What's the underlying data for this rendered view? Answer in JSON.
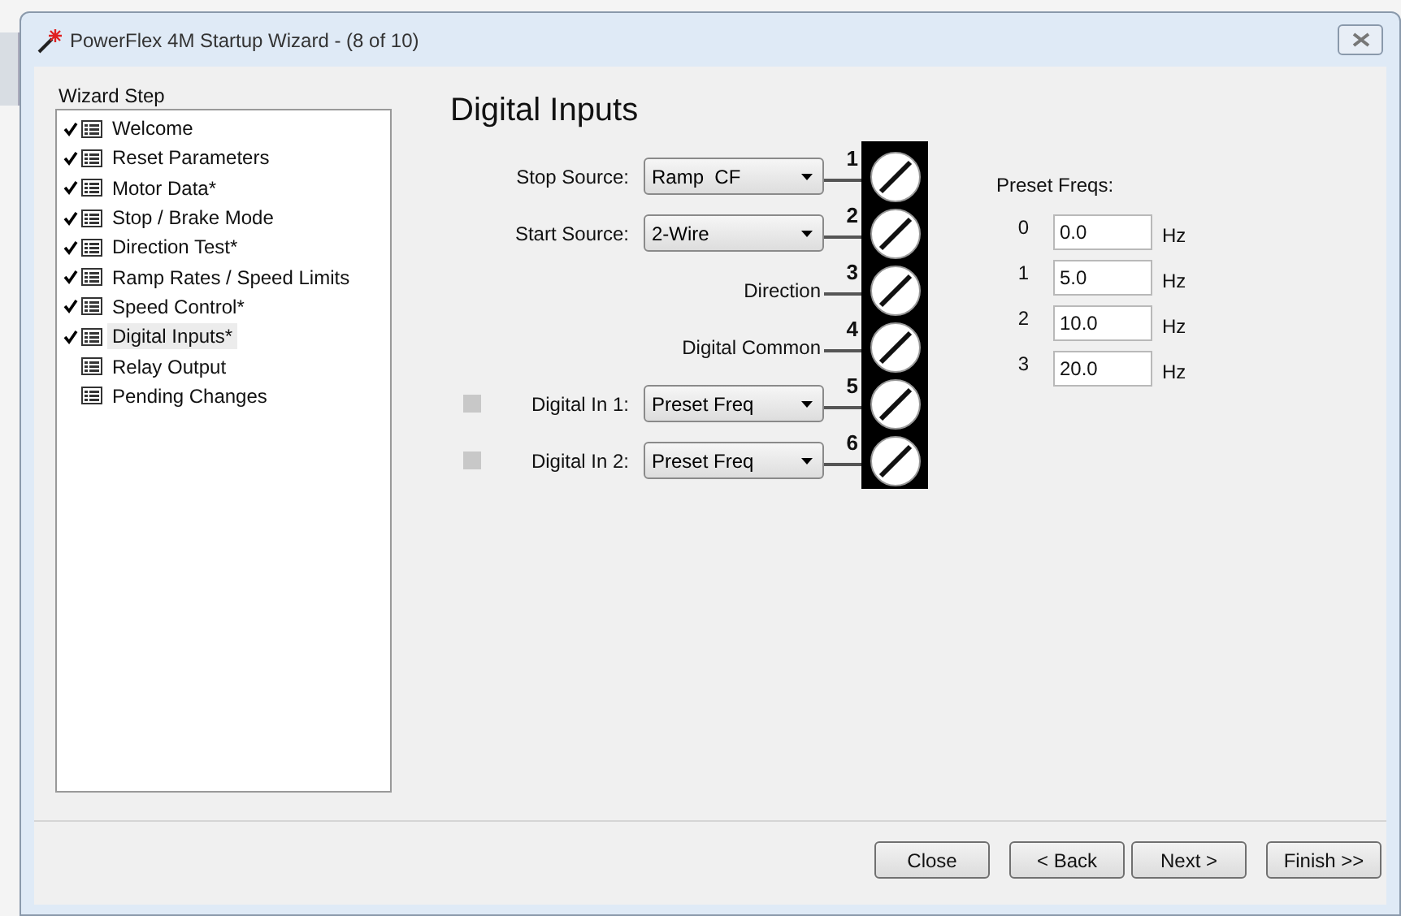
{
  "window": {
    "title": "PowerFlex 4M Startup Wizard - (8 of 10)"
  },
  "sidebar": {
    "title": "Wizard Step",
    "items": [
      {
        "label": "Welcome",
        "checked": true,
        "selected": false
      },
      {
        "label": "Reset Parameters",
        "checked": true,
        "selected": false
      },
      {
        "label": "Motor Data*",
        "checked": true,
        "selected": false
      },
      {
        "label": "Stop / Brake Mode",
        "checked": true,
        "selected": false
      },
      {
        "label": "Direction Test*",
        "checked": true,
        "selected": false
      },
      {
        "label": "Ramp Rates / Speed Limits",
        "checked": true,
        "selected": false
      },
      {
        "label": "Speed Control*",
        "checked": true,
        "selected": false
      },
      {
        "label": "Digital Inputs*",
        "checked": true,
        "selected": true
      },
      {
        "label": "Relay Output",
        "checked": false,
        "selected": false
      },
      {
        "label": "Pending Changes",
        "checked": false,
        "selected": false
      }
    ]
  },
  "page": {
    "title": "Digital Inputs",
    "terminals": [
      {
        "kind": "select",
        "number": "1",
        "label": "Stop Source:",
        "value": "Ramp  CF"
      },
      {
        "kind": "select",
        "number": "2",
        "label": "Start Source:",
        "value": "2-Wire"
      },
      {
        "kind": "text",
        "number": "3",
        "label": "Direction"
      },
      {
        "kind": "text",
        "number": "4",
        "label": "Digital Common"
      },
      {
        "kind": "input",
        "number": "5",
        "label": "Digital In 1:",
        "value": "Preset Freq",
        "on": false
      },
      {
        "kind": "input",
        "number": "6",
        "label": "Digital In 2:",
        "value": "Preset Freq",
        "on": false
      }
    ],
    "preset_freqs": {
      "title": "Preset Freqs:",
      "rows": [
        {
          "index": "0",
          "value": "0.0",
          "unit": "Hz"
        },
        {
          "index": "1",
          "value": "5.0",
          "unit": "Hz"
        },
        {
          "index": "2",
          "value": "10.0",
          "unit": "Hz"
        },
        {
          "index": "3",
          "value": "20.0",
          "unit": "Hz"
        }
      ]
    }
  },
  "buttons": [
    "Close",
    "< Back",
    "Next >",
    "Finish >>"
  ]
}
